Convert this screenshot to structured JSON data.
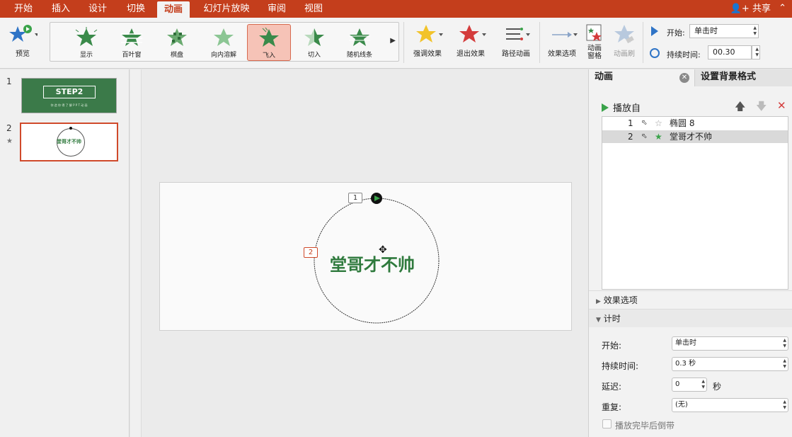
{
  "tabs": [
    {
      "label": "开始"
    },
    {
      "label": "插入"
    },
    {
      "label": "设计"
    },
    {
      "label": "切换"
    },
    {
      "label": "动画"
    },
    {
      "label": "幻灯片放映"
    },
    {
      "label": "审阅"
    },
    {
      "label": "视图"
    }
  ],
  "share_label": "共享",
  "ribbon": {
    "preview_label": "预览",
    "gallery": [
      {
        "label": "显示"
      },
      {
        "label": "百叶窗"
      },
      {
        "label": "棋盘"
      },
      {
        "label": "向内溶解"
      },
      {
        "label": "飞入"
      },
      {
        "label": "切入"
      },
      {
        "label": "随机线条"
      }
    ],
    "emphasis_label": "强调效果",
    "exit_label": "退出效果",
    "path_label": "路径动画",
    "effect_options_label": "效果选项",
    "anim_pane_label": "动画\n窗格",
    "anim_brush_label": "动画刷",
    "start_label": "开始:",
    "start_value": "单击时",
    "duration_label": "持续时间:",
    "duration_value": "00.30"
  },
  "thumbnails": [
    {
      "num": "1",
      "title": "STEP2",
      "sub": "你 造 你 得 了 解 P P T 动 画"
    },
    {
      "num": "2",
      "text": "堂哥才不帅"
    }
  ],
  "slide": {
    "tag1": "1",
    "tag2": "2",
    "text": "堂哥才不帅"
  },
  "pane": {
    "tab_animation": "动画",
    "tab_bg_format": "设置背景格式",
    "play_from": "播放自",
    "list": [
      {
        "num": "1",
        "name": "椭圆 8"
      },
      {
        "num": "2",
        "name": "堂哥才不帅"
      }
    ],
    "effect_options": "效果选项",
    "timing": "计时",
    "start_label": "开始:",
    "start_value": "单击时",
    "duration_label": "持续时间:",
    "duration_value": "0.3 秒",
    "delay_label": "延迟:",
    "delay_value": "0",
    "delay_unit": "秒",
    "repeat_label": "重复:",
    "repeat_value": "(无)",
    "rewind_label": "播放完毕后倒带"
  },
  "colors": {
    "accent": "#c43e1c",
    "green": "#2f7a3d",
    "selected_bg": "#f6c3b7"
  }
}
